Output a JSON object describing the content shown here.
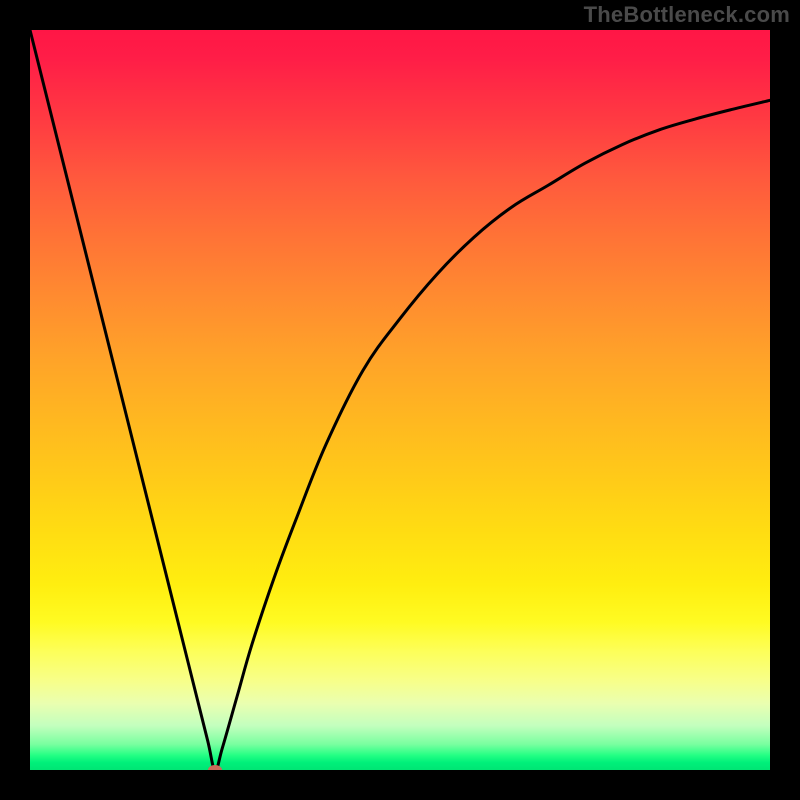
{
  "watermark": "TheBottleneck.com",
  "chart_data": {
    "type": "line",
    "title": "",
    "xlabel": "",
    "ylabel": "",
    "xlim": [
      0,
      100
    ],
    "ylim": [
      0,
      100
    ],
    "grid": false,
    "legend": false,
    "series": [
      {
        "name": "bottleneck-curve",
        "x": [
          0,
          5,
          10,
          15,
          20,
          22,
          24,
          25,
          26,
          28,
          30,
          33,
          36,
          40,
          45,
          50,
          55,
          60,
          65,
          70,
          75,
          80,
          85,
          90,
          95,
          100
        ],
        "y": [
          100,
          80,
          60,
          40,
          20,
          12,
          4,
          0,
          3,
          10,
          17,
          26,
          34,
          44,
          54,
          61,
          67,
          72,
          76,
          79,
          82,
          84.5,
          86.5,
          88,
          89.3,
          90.5
        ]
      }
    ],
    "marker": {
      "x": 25,
      "y": 0,
      "color": "#cc6a5a",
      "rx": 7,
      "ry": 5
    },
    "gradient_stops": [
      {
        "pct": 0,
        "color": "#ff1646"
      },
      {
        "pct": 50,
        "color": "#ffbf1c"
      },
      {
        "pct": 85,
        "color": "#fcff6e"
      },
      {
        "pct": 100,
        "color": "#00e574"
      }
    ]
  }
}
